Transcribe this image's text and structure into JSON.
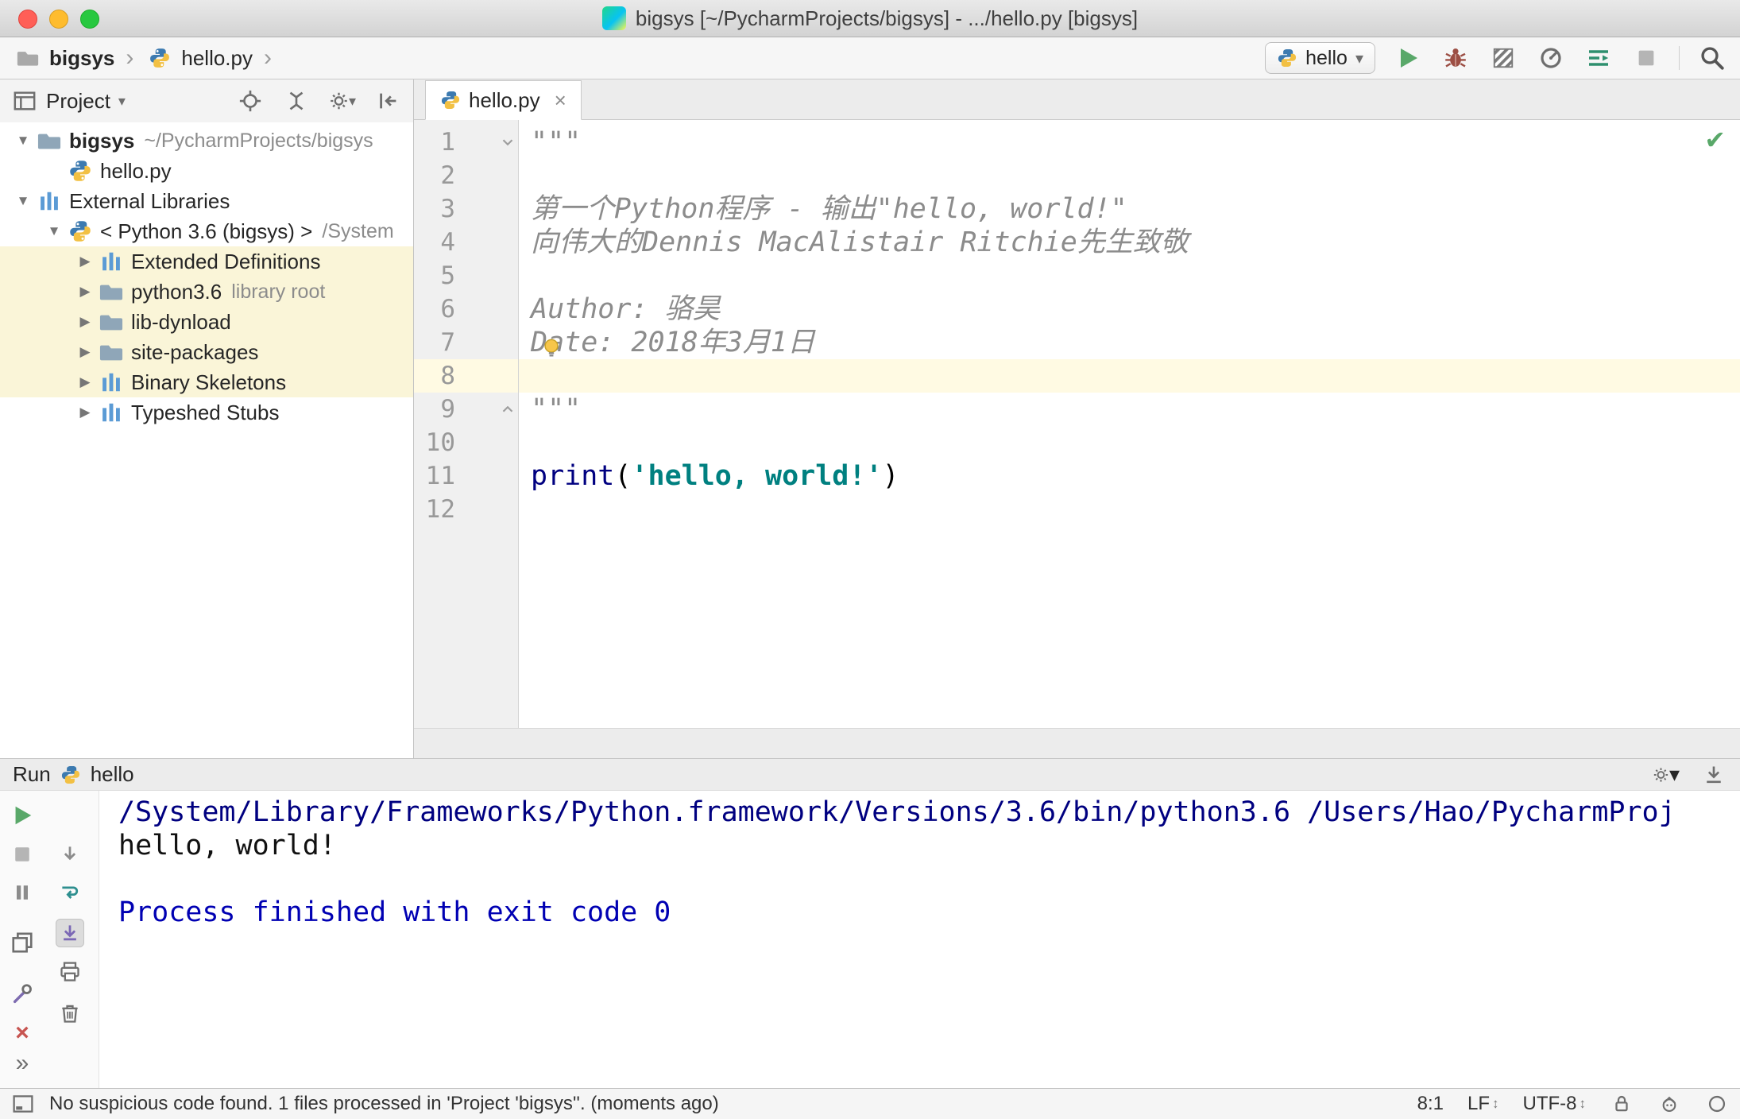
{
  "titlebar": {
    "title": "bigsys [~/PycharmProjects/bigsys] - .../hello.py [bigsys]"
  },
  "navbar": {
    "breadcrumbs": [
      "bigsys",
      "hello.py"
    ],
    "run_config_label": "hello"
  },
  "project_panel": {
    "title": "Project",
    "tree": [
      {
        "label": "bigsys",
        "suffix": "~/PycharmProjects/bigsys",
        "level": 0,
        "state": "expanded",
        "icon": "folder",
        "bold": true
      },
      {
        "label": "hello.py",
        "level": 1,
        "state": "none",
        "icon": "python-file"
      },
      {
        "label": "External Libraries",
        "level": 0,
        "state": "expanded",
        "icon": "library"
      },
      {
        "label": "< Python 3.6 (bigsys) >",
        "suffix": "/System",
        "level": 1,
        "state": "expanded",
        "icon": "python-interpreter"
      },
      {
        "label": "Extended Definitions",
        "level": 2,
        "state": "collapsed",
        "icon": "library",
        "highlighted": true
      },
      {
        "label": "python3.6",
        "suffix": "library root",
        "level": 2,
        "state": "collapsed",
        "icon": "folder",
        "highlighted": true
      },
      {
        "label": "lib-dynload",
        "level": 2,
        "state": "collapsed",
        "icon": "folder",
        "highlighted": true
      },
      {
        "label": "site-packages",
        "level": 2,
        "state": "collapsed",
        "icon": "folder",
        "highlighted": true
      },
      {
        "label": "Binary Skeletons",
        "level": 2,
        "state": "collapsed",
        "icon": "library",
        "highlighted": true
      },
      {
        "label": "Typeshed Stubs",
        "level": 2,
        "state": "collapsed",
        "icon": "library"
      }
    ]
  },
  "editor": {
    "tab_label": "hello.py",
    "current_line": 8,
    "fold_start_line": 1,
    "fold_end_line": 9,
    "lines": [
      {
        "num": 1,
        "segments": [
          {
            "text": "\"\"\"",
            "style": "doc"
          }
        ]
      },
      {
        "num": 2,
        "segments": []
      },
      {
        "num": 3,
        "segments": [
          {
            "text": "第一个Python程序 - 输出\"hello, world!\"",
            "style": "doc"
          }
        ]
      },
      {
        "num": 4,
        "segments": [
          {
            "text": "向伟大的Dennis MacAlistair Ritchie先生致敬",
            "style": "doc"
          }
        ]
      },
      {
        "num": 5,
        "segments": []
      },
      {
        "num": 6,
        "segments": [
          {
            "text": "Author: 骆昊",
            "style": "doc"
          }
        ]
      },
      {
        "num": 7,
        "segments": [
          {
            "text": "Date: 2018年3月1日",
            "style": "doc"
          }
        ]
      },
      {
        "num": 8,
        "segments": []
      },
      {
        "num": 9,
        "segments": [
          {
            "text": "\"\"\"",
            "style": "doc"
          }
        ]
      },
      {
        "num": 10,
        "segments": []
      },
      {
        "num": 11,
        "segments": [
          {
            "text": "print",
            "style": "keyword"
          },
          {
            "text": "(",
            "style": "plain"
          },
          {
            "text": "'hello, world!'",
            "style": "string"
          },
          {
            "text": ")",
            "style": "plain"
          }
        ]
      },
      {
        "num": 12,
        "segments": []
      }
    ]
  },
  "run_panel": {
    "title": "Run",
    "tab_label": "hello",
    "console_lines": [
      {
        "text": "/System/Library/Frameworks/Python.framework/Versions/3.6/bin/python3.6 /Users/Hao/PycharmProj",
        "style": "command"
      },
      {
        "text": "hello, world!",
        "style": "stdout"
      },
      {
        "text": "",
        "style": "stdout"
      },
      {
        "text": "Process finished with exit code 0",
        "style": "info"
      }
    ]
  },
  "statusbar": {
    "message": "No suspicious code found. 1 files processed in 'Project 'bigsys''. (moments ago)",
    "caret_position": "8:1",
    "line_separator": "LF",
    "encoding": "UTF-8"
  },
  "colors": {
    "accent_green": "#59a869",
    "doc_string": "#8c8c8c",
    "keyword": "#000080",
    "string": "#008080",
    "console_command": "#000080",
    "console_info": "#0000b3",
    "current_line": "#fffae3",
    "library_highlight": "#faf5d8"
  }
}
